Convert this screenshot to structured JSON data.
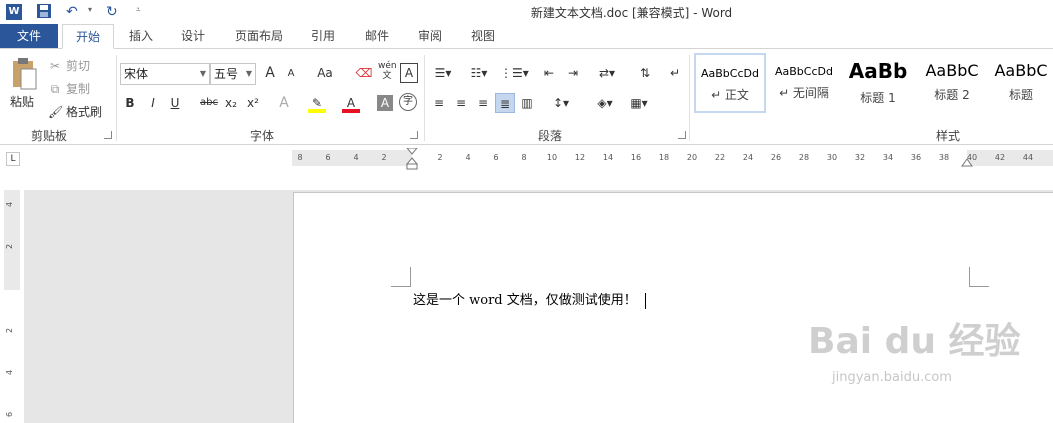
{
  "titlebar": {
    "app_icon": "W",
    "title": "新建文本文档.doc [兼容模式] - Word",
    "icons": [
      "save-icon",
      "undo-icon",
      "redo-icon",
      "customize-icon"
    ]
  },
  "tabs": [
    "文件",
    "开始",
    "插入",
    "设计",
    "页面布局",
    "引用",
    "邮件",
    "审阅",
    "视图"
  ],
  "clipboard": {
    "paste": "粘贴",
    "cut": "剪切",
    "copy": "复制",
    "format_painter": "格式刷",
    "label": "剪贴板"
  },
  "font": {
    "name": "宋体",
    "size": "五号",
    "label": "字体",
    "bold": "B",
    "italic": "I",
    "underline": "U",
    "strike": "abc",
    "sub": "x₂",
    "sup": "x²",
    "grow": "A",
    "shrink": "A",
    "case": "Aa",
    "phonetic": "wén\n文",
    "border": "A",
    "effects": "A",
    "color": "A",
    "shade": "A",
    "enclose": "字"
  },
  "paragraph": {
    "label": "段落"
  },
  "styles": {
    "label": "样式",
    "items": [
      {
        "sample": "AaBbCcDd",
        "name": "↵ 正文"
      },
      {
        "sample": "AaBbCcDd",
        "name": "↵ 无间隔"
      },
      {
        "sample": "AaBb",
        "name": "标题 1"
      },
      {
        "sample": "AaBbC",
        "name": "标题 2"
      },
      {
        "sample": "AaBbC",
        "name": "标题"
      }
    ]
  },
  "ruler": {
    "corner": "L",
    "h_ticks": [
      "8",
      "6",
      "4",
      "2",
      "",
      "2",
      "4",
      "6",
      "8",
      "10",
      "12",
      "14",
      "16",
      "18",
      "20",
      "22",
      "24",
      "26",
      "28",
      "30",
      "32",
      "34",
      "36",
      "38",
      "40",
      "42",
      "44"
    ],
    "v_ticks": [
      "4",
      "2",
      "",
      "2",
      "4",
      "6"
    ]
  },
  "document": {
    "text": "这是一个 word 文档，仅做测试使用！"
  },
  "watermark": {
    "logo": "Bai du 经验",
    "url": "jingyan.baidu.com"
  },
  "colors": {
    "accent": "#2b579a",
    "font_color": "#e81123",
    "highlight": "#ffff00"
  }
}
